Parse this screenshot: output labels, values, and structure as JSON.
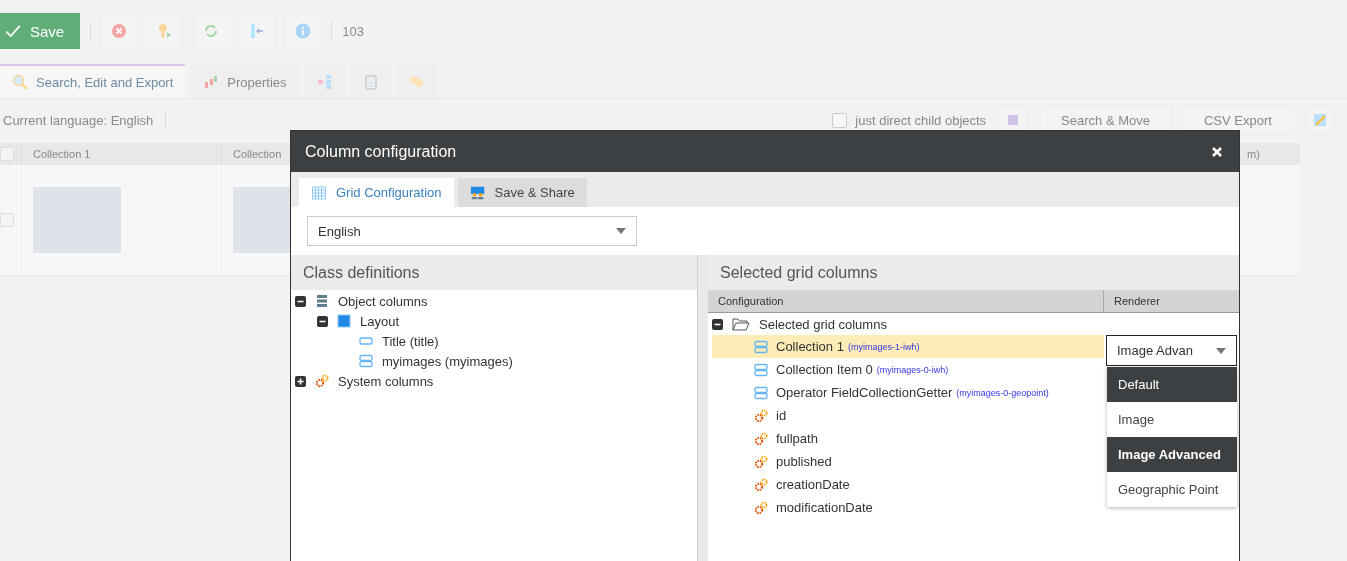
{
  "toolbar": {
    "save_label": "Save",
    "count": "103"
  },
  "tabs": [
    {
      "label": "Search, Edit and Export",
      "selected": true
    },
    {
      "label": "Properties",
      "selected": false
    }
  ],
  "filter_bar": {
    "language_label": "Current language: English",
    "direct_children": {
      "label": "just direct child objects",
      "checked": false
    },
    "buttons": [
      "Search & Move",
      "CSV Export"
    ]
  },
  "grid": {
    "columns": [
      "Collection 1",
      "Collection",
      "m)"
    ],
    "select_all_checked": false,
    "rows": [
      {
        "checked": false
      }
    ]
  },
  "dialog": {
    "title": "Column configuration",
    "tabs": [
      {
        "label": "Grid Configuration",
        "selected": true
      },
      {
        "label": "Save & Share",
        "selected": false
      }
    ],
    "language_select": {
      "value": "English"
    },
    "class_definitions": {
      "title": "Class definitions",
      "tree": [
        {
          "label": "Object columns",
          "kind": "group",
          "expanded": true,
          "children": [
            {
              "label": "Layout",
              "kind": "layout",
              "expanded": true,
              "children": [
                {
                  "label": "Title (title)",
                  "kind": "input"
                },
                {
                  "label": "myimages (myimages)",
                  "kind": "collection"
                }
              ]
            }
          ]
        },
        {
          "label": "System columns",
          "kind": "system",
          "expanded": false
        }
      ]
    },
    "selected_columns": {
      "title": "Selected grid columns",
      "columns": [
        "Configuration",
        "Renderer"
      ],
      "root": {
        "label": "Selected grid columns",
        "expanded": true
      },
      "rows": [
        {
          "label": "Collection 1",
          "key": "(myimages-1-iwh)",
          "kind": "collection",
          "selected": true
        },
        {
          "label": "Collection Item 0",
          "key": "(myimages-0-iwh)",
          "kind": "collection",
          "selected": false
        },
        {
          "label": "Operator FieldCollectionGetter",
          "key": "(myimages-0-geopoint)",
          "kind": "collection",
          "selected": false
        },
        {
          "label": "id",
          "kind": "system",
          "selected": false
        },
        {
          "label": "fullpath",
          "kind": "system",
          "selected": false
        },
        {
          "label": "published",
          "kind": "system",
          "selected": false
        },
        {
          "label": "creationDate",
          "kind": "system",
          "selected": false
        },
        {
          "label": "modificationDate",
          "kind": "system",
          "selected": false
        }
      ]
    },
    "renderer_select": {
      "value": "Image Advan",
      "options": [
        {
          "label": "Default",
          "hovered": true,
          "selected": false
        },
        {
          "label": "Image",
          "hovered": false,
          "selected": false
        },
        {
          "label": "Image Advanced",
          "hovered": false,
          "selected": true
        },
        {
          "label": "Geographic Point",
          "hovered": false,
          "selected": false
        }
      ]
    }
  }
}
